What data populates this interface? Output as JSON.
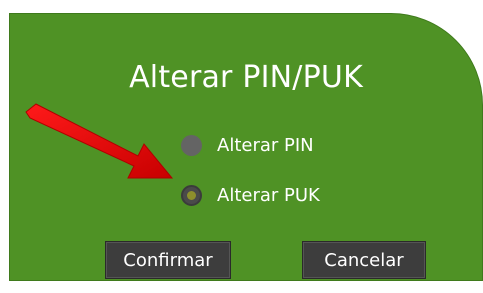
{
  "dialog": {
    "title": "Alterar PIN/PUK",
    "options": [
      {
        "label": "Alterar PIN",
        "selected": false
      },
      {
        "label": "Alterar PUK",
        "selected": true
      }
    ],
    "confirm_label": "Confirmar",
    "cancel_label": "Cancelar"
  },
  "colors": {
    "panel_background": "#4f9225",
    "button_background": "#3d3d3d",
    "arrow": "#e00000",
    "radio_unselected": "#646464",
    "radio_selected_dot": "#8d8f2c"
  },
  "annotation": {
    "icon": "red-arrow-icon"
  }
}
